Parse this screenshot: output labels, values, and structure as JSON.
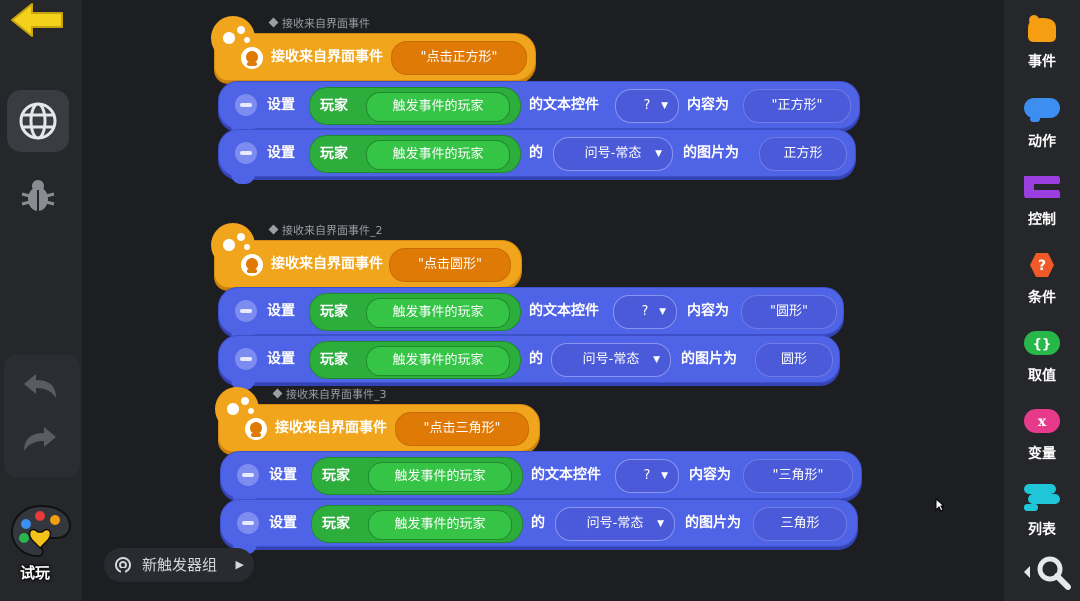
{
  "toolbar": {
    "back_icon": "back-arrow-icon",
    "play_label": "试玩"
  },
  "palette": {
    "categories": [
      {
        "label": "事件",
        "icon": "event-icon",
        "color": "#f59e12"
      },
      {
        "label": "动作",
        "icon": "action-icon",
        "color": "#3d8ef0"
      },
      {
        "label": "控制",
        "icon": "control-icon",
        "color": "#9b3ee0"
      },
      {
        "label": "条件",
        "icon": "condition-icon",
        "color": "#f05a28"
      },
      {
        "label": "取值",
        "icon": "value-icon",
        "color": "#28b84a"
      },
      {
        "label": "变量",
        "icon": "variable-icon",
        "color": "#e83a8a"
      },
      {
        "label": "列表",
        "icon": "list-icon",
        "color": "#1ec6d8"
      }
    ]
  },
  "groups": [
    {
      "label": "接收来自界面事件",
      "event_text": "接收来自界面事件",
      "event_value": "\"点击正方形\"",
      "actions": [
        {
          "set": "设置",
          "player": "玩家",
          "player_value": "触发事件的玩家",
          "mid": "的文本控件",
          "dropdown": "?",
          "tail": "内容为",
          "value": "\"正方形\""
        },
        {
          "set": "设置",
          "player": "玩家",
          "player_value": "触发事件的玩家",
          "mid": "的",
          "dropdown": "问号-常态",
          "tail": "的图片为",
          "value": "正方形"
        }
      ]
    },
    {
      "label": "接收来自界面事件_2",
      "event_text": "接收来自界面事件",
      "event_value": "\"点击圆形\"",
      "actions": [
        {
          "set": "设置",
          "player": "玩家",
          "player_value": "触发事件的玩家",
          "mid": "的文本控件",
          "dropdown": "?",
          "tail": "内容为",
          "value": "\"圆形\""
        },
        {
          "set": "设置",
          "player": "玩家",
          "player_value": "触发事件的玩家",
          "mid": "的",
          "dropdown": "问号-常态",
          "tail": "的图片为",
          "value": "圆形"
        }
      ]
    },
    {
      "label": "接收来自界面事件_3",
      "event_text": "接收来自界面事件",
      "event_value": "\"点击三角形\"",
      "actions": [
        {
          "set": "设置",
          "player": "玩家",
          "player_value": "触发事件的玩家",
          "mid": "的文本控件",
          "dropdown": "?",
          "tail": "内容为",
          "value": "\"三角形\""
        },
        {
          "set": "设置",
          "player": "玩家",
          "player_value": "触发事件的玩家",
          "mid": "的",
          "dropdown": "问号-常态",
          "tail": "的图片为",
          "value": "三角形"
        }
      ]
    }
  ],
  "new_group_label": "新触发器组"
}
